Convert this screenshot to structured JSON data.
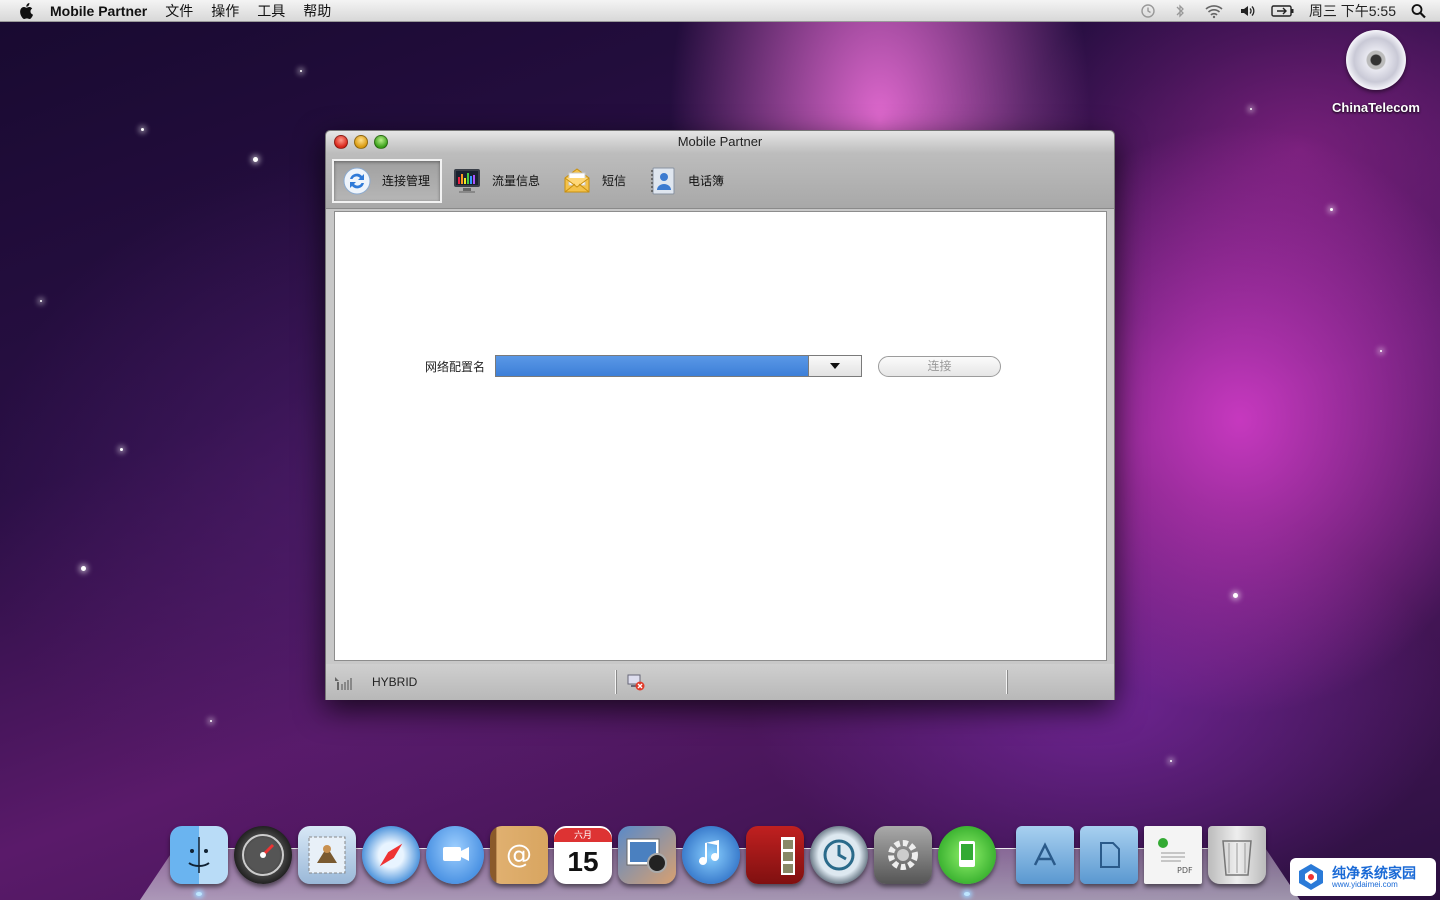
{
  "menubar": {
    "app_name": "Mobile Partner",
    "items": [
      "文件",
      "操作",
      "工具",
      "帮助"
    ],
    "clock": "周三 下午5:55"
  },
  "desktop": {
    "disk_label": "ChinaTelecom"
  },
  "window": {
    "title": "Mobile Partner",
    "toolbar": [
      {
        "label": "连接管理",
        "icon": "refresh-icon",
        "active": true
      },
      {
        "label": "流量信息",
        "icon": "monitor-icon",
        "active": false
      },
      {
        "label": "短信",
        "icon": "envelope-icon",
        "active": false
      },
      {
        "label": "电话簿",
        "icon": "contacts-icon",
        "active": false
      }
    ],
    "form": {
      "profile_label": "网络配置名",
      "profile_value": "",
      "connect_label": "连接"
    },
    "status": {
      "network_type": "HYBRID"
    }
  },
  "dock": {
    "items": [
      "finder",
      "dashboard",
      "mail",
      "safari",
      "ichat",
      "address-book",
      "ical",
      "iphoto",
      "itunes",
      "photo-booth",
      "time-machine",
      "system-preferences",
      "mobile-partner",
      "applications-folder",
      "documents-folder",
      "pdf-file",
      "trash"
    ],
    "calendar_day": "15",
    "calendar_month": "六月"
  },
  "watermark": {
    "title": "纯净系统家园",
    "url": "www.yidaimei.com"
  }
}
